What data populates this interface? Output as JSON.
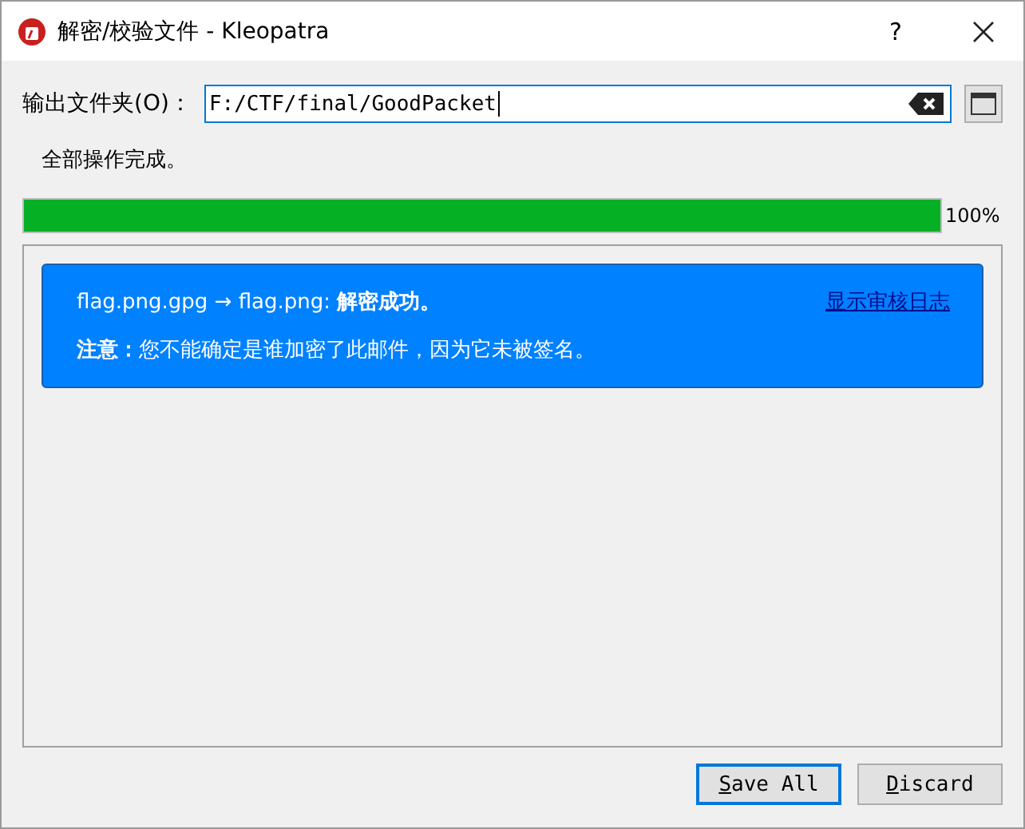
{
  "window": {
    "title": "解密/校验文件 - Kleopatra",
    "help": "?"
  },
  "output_folder": {
    "label": "输出文件夹(O)：",
    "value": "F:/CTF/final/GoodPacket"
  },
  "status": "全部操作完成。",
  "progress": {
    "level": 1,
    "reading": "100%"
  },
  "results": [
    {
      "message": "flag.png.gpg → flag.png: **解密成功。**",
      "note": "**注意：**您不能确定是谁加密了此邮件，因为它未被签名。",
      "link": "显示审核日志"
    }
  ],
  "buttons": [
    {
      "label": "Save All",
      "default": true
    },
    {
      "label": "Discard",
      "default": false
    }
  ]
}
